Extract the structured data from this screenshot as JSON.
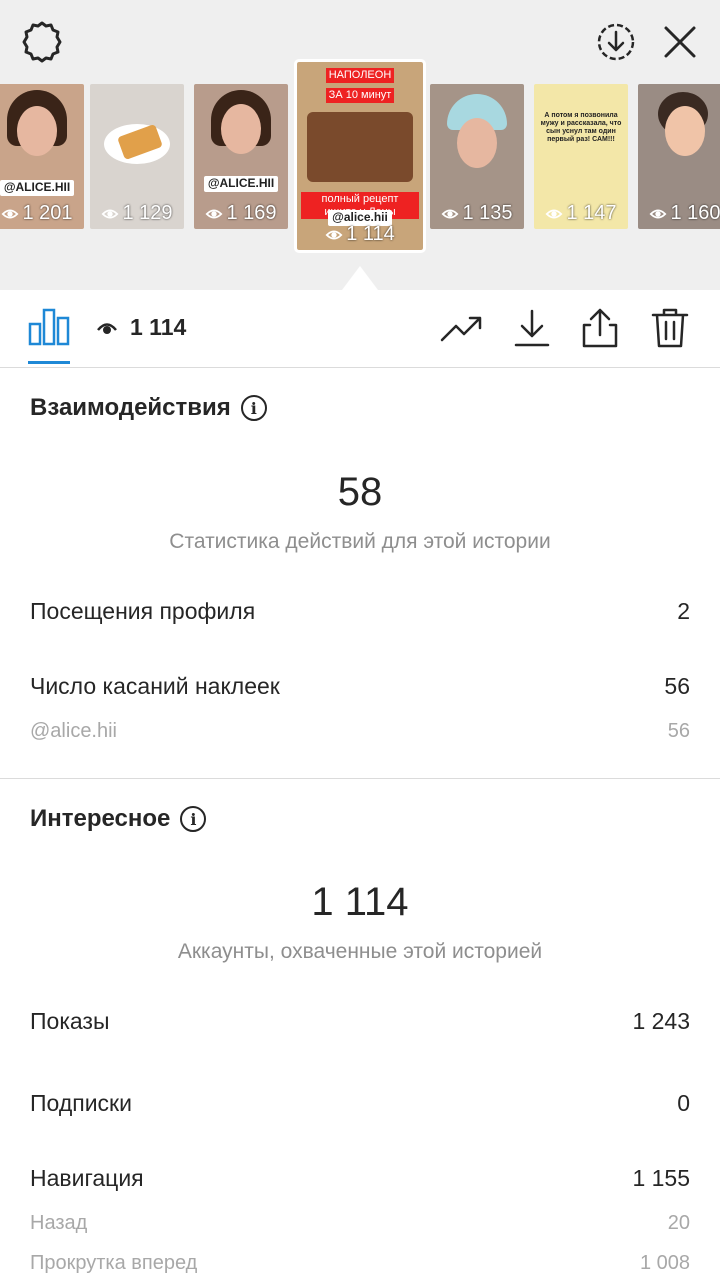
{
  "story_strip": {
    "thumbnails": [
      {
        "views": "1 201",
        "sticker": "@ALICE.HII"
      },
      {
        "views": "1 129"
      },
      {
        "views": "1 169",
        "sticker": "@ALICE.HII"
      },
      {
        "views": "1 114",
        "caption_top": "НАПОЛЕОН",
        "caption_sub": "ЗА 10 минут",
        "caption_red": "полный рецепт ищите у Лены",
        "sticker": "@alice.hii"
      },
      {
        "views": "1 135"
      },
      {
        "views": "1 147",
        "caption_top": "А потом я позвонила мужу и рассказала, что сын уснул там один первый раз! САМ!!!"
      },
      {
        "views": "1 160"
      }
    ]
  },
  "toolbar": {
    "views": "1 114"
  },
  "interactions": {
    "title": "Взаимодействия",
    "total": "58",
    "subtitle": "Статистика действий для этой истории",
    "profile_visits_label": "Посещения профиля",
    "profile_visits_value": "2",
    "sticker_taps_label": "Число касаний наклеек",
    "sticker_taps_value": "56",
    "sticker_handle_label": "@alice.hii",
    "sticker_handle_value": "56"
  },
  "discovery": {
    "title": "Интересное",
    "total": "1 114",
    "subtitle": "Аккаунты, охваченные этой историей",
    "impressions_label": "Показы",
    "impressions_value": "1 243",
    "follows_label": "Подписки",
    "follows_value": "0",
    "navigation_label": "Навигация",
    "navigation_value": "1 155",
    "back_label": "Назад",
    "back_value": "20",
    "forward_label": "Прокрутка вперед",
    "forward_value": "1 008"
  },
  "colors": {
    "accent": "#1e88d6",
    "muted": "#8e8e8e"
  }
}
